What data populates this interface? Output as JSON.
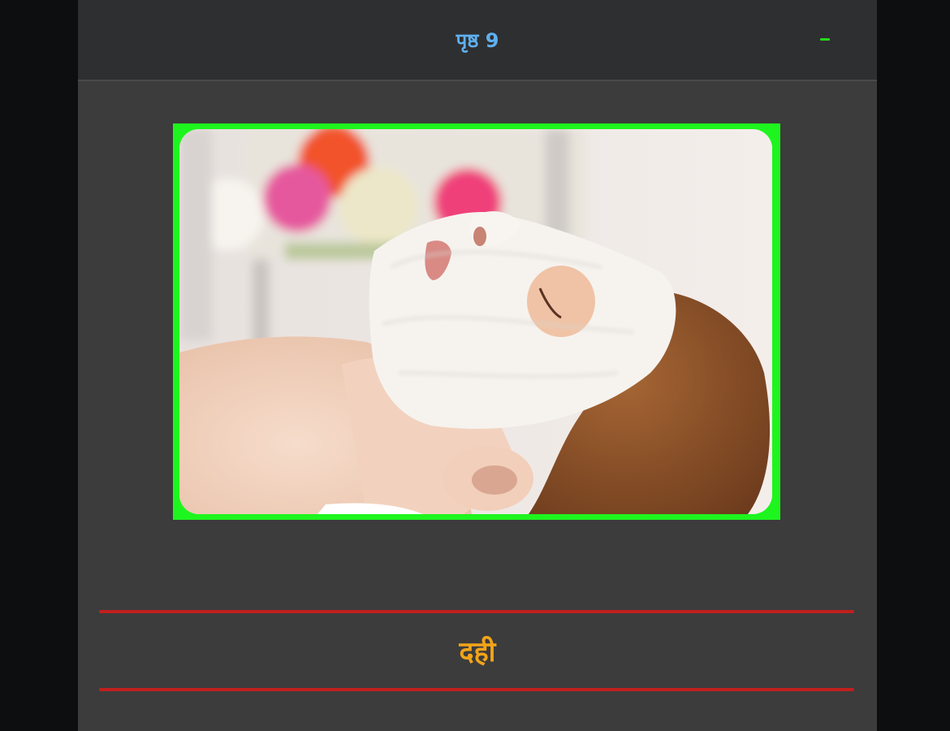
{
  "header": {
    "title": "पृष्ठ 9",
    "collapse_icon": "minus-icon",
    "accent_color": "#26d81d",
    "title_color": "#5fb0ee"
  },
  "main": {
    "image": {
      "icon": "spa-face-mask-photo",
      "border_color": "#1ef51e"
    },
    "word": "दही",
    "word_color": "#f2a419",
    "rule_color": "#c0201d"
  }
}
